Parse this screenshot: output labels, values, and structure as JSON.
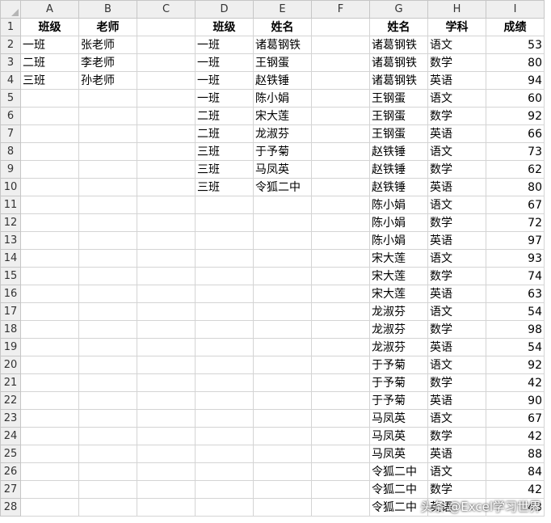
{
  "columns": [
    "A",
    "B",
    "C",
    "D",
    "E",
    "F",
    "G",
    "H",
    "I"
  ],
  "rows": [
    [
      "班级",
      "老师",
      "",
      "班级",
      "姓名",
      "",
      "姓名",
      "学科",
      "成绩"
    ],
    [
      "一班",
      "张老师",
      "",
      "一班",
      "诸葛钢铁",
      "",
      "诸葛钢铁",
      "语文",
      "53"
    ],
    [
      "二班",
      "李老师",
      "",
      "一班",
      "王钢蛋",
      "",
      "诸葛钢铁",
      "数学",
      "80"
    ],
    [
      "三班",
      "孙老师",
      "",
      "一班",
      "赵铁锤",
      "",
      "诸葛钢铁",
      "英语",
      "94"
    ],
    [
      "",
      "",
      "",
      "一班",
      "陈小娟",
      "",
      "王钢蛋",
      "语文",
      "60"
    ],
    [
      "",
      "",
      "",
      "二班",
      "宋大莲",
      "",
      "王钢蛋",
      "数学",
      "92"
    ],
    [
      "",
      "",
      "",
      "二班",
      "龙淑芬",
      "",
      "王钢蛋",
      "英语",
      "66"
    ],
    [
      "",
      "",
      "",
      "三班",
      "于予菊",
      "",
      "赵铁锤",
      "语文",
      "73"
    ],
    [
      "",
      "",
      "",
      "三班",
      "马凤英",
      "",
      "赵铁锤",
      "数学",
      "62"
    ],
    [
      "",
      "",
      "",
      "三班",
      "令狐二中",
      "",
      "赵铁锤",
      "英语",
      "80"
    ],
    [
      "",
      "",
      "",
      "",
      "",
      "",
      "陈小娟",
      "语文",
      "67"
    ],
    [
      "",
      "",
      "",
      "",
      "",
      "",
      "陈小娟",
      "数学",
      "72"
    ],
    [
      "",
      "",
      "",
      "",
      "",
      "",
      "陈小娟",
      "英语",
      "97"
    ],
    [
      "",
      "",
      "",
      "",
      "",
      "",
      "宋大莲",
      "语文",
      "93"
    ],
    [
      "",
      "",
      "",
      "",
      "",
      "",
      "宋大莲",
      "数学",
      "74"
    ],
    [
      "",
      "",
      "",
      "",
      "",
      "",
      "宋大莲",
      "英语",
      "63"
    ],
    [
      "",
      "",
      "",
      "",
      "",
      "",
      "龙淑芬",
      "语文",
      "54"
    ],
    [
      "",
      "",
      "",
      "",
      "",
      "",
      "龙淑芬",
      "数学",
      "98"
    ],
    [
      "",
      "",
      "",
      "",
      "",
      "",
      "龙淑芬",
      "英语",
      "54"
    ],
    [
      "",
      "",
      "",
      "",
      "",
      "",
      "于予菊",
      "语文",
      "92"
    ],
    [
      "",
      "",
      "",
      "",
      "",
      "",
      "于予菊",
      "数学",
      "42"
    ],
    [
      "",
      "",
      "",
      "",
      "",
      "",
      "于予菊",
      "英语",
      "90"
    ],
    [
      "",
      "",
      "",
      "",
      "",
      "",
      "马凤英",
      "语文",
      "67"
    ],
    [
      "",
      "",
      "",
      "",
      "",
      "",
      "马凤英",
      "数学",
      "42"
    ],
    [
      "",
      "",
      "",
      "",
      "",
      "",
      "马凤英",
      "英语",
      "88"
    ],
    [
      "",
      "",
      "",
      "",
      "",
      "",
      "令狐二中",
      "语文",
      "84"
    ],
    [
      "",
      "",
      "",
      "",
      "",
      "",
      "令狐二中",
      "数学",
      "42"
    ],
    [
      "",
      "",
      "",
      "",
      "",
      "",
      "令狐二中",
      "英语",
      "43"
    ]
  ],
  "watermark": "头条 @Excel学习世界"
}
